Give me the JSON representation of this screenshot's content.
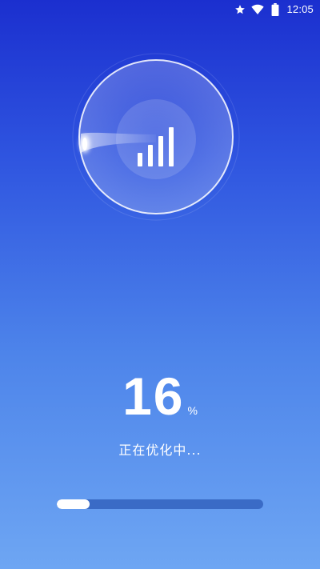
{
  "status_bar": {
    "time": "12:05",
    "icons": [
      "star-icon",
      "wifi-icon",
      "battery-icon"
    ]
  },
  "optimizer": {
    "percent_value": "16",
    "percent_unit": "%",
    "status_text": "正在优化中...",
    "progress": 0.16,
    "scanner_icon": "signal-bars-icon"
  },
  "colors": {
    "background_top": "#1b2fcf",
    "background_bottom": "#6ea6f3",
    "progress_track": "#3a6bc6",
    "progress_fill": "#ffffff",
    "text": "#ffffff"
  }
}
